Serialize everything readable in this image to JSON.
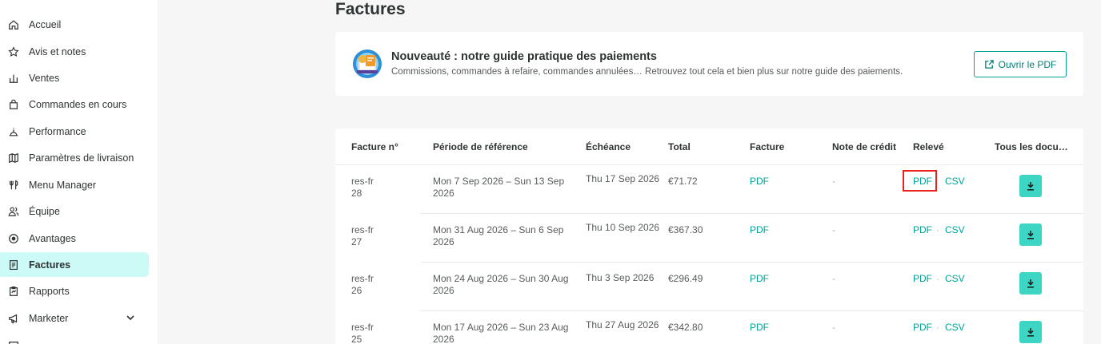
{
  "sidebar": {
    "items": [
      {
        "label": "Accueil",
        "icon": "home-icon"
      },
      {
        "label": "Avis et notes",
        "icon": "star-icon"
      },
      {
        "label": "Ventes",
        "icon": "bar-chart-icon"
      },
      {
        "label": "Commandes en cours",
        "icon": "bag-icon"
      },
      {
        "label": "Performance",
        "icon": "gauge-icon"
      },
      {
        "label": "Paramètres de livraison",
        "icon": "map-icon"
      },
      {
        "label": "Menu Manager",
        "icon": "cutlery-icon"
      },
      {
        "label": "Équipe",
        "icon": "people-icon"
      },
      {
        "label": "Avantages",
        "icon": "badge-icon"
      },
      {
        "label": "Factures",
        "icon": "document-icon",
        "active": true
      },
      {
        "label": "Rapports",
        "icon": "clipboard-icon"
      },
      {
        "label": "Marketer",
        "icon": "megaphone-icon",
        "expandable": true
      }
    ]
  },
  "page": {
    "title": "Factures"
  },
  "banner": {
    "title": "Nouveauté : notre guide pratique des paiements",
    "subtitle": "Commissions, commandes à refaire, commandes annulées… Retrouvez tout cela et bien plus sur notre guide des paiements.",
    "button_label": "Ouvrir le PDF"
  },
  "table": {
    "headers": {
      "invoice_no": "Facture n°",
      "period": "Période de référence",
      "due": "Échéance",
      "total": "Total",
      "invoice": "Facture",
      "credit_note": "Note de crédit",
      "statement": "Relevé",
      "all_docs": "Tous les docu…"
    },
    "rows": [
      {
        "no": "res-fr 28",
        "period": "Mon 7 Sep 2026 – Sun 13 Sep 2026",
        "due": "Thu 17 Sep 2026",
        "total": "€71.72",
        "invoice": "PDF",
        "credit_note": "-",
        "statement_pdf": "PDF",
        "statement_sep": "·",
        "statement_csv": "CSV"
      },
      {
        "no": "res-fr 27",
        "period": "Mon 31 Aug 2026 – Sun 6 Sep 2026",
        "due": "Thu 10 Sep 2026",
        "total": "€367.30",
        "invoice": "PDF",
        "credit_note": "-",
        "statement_pdf": "PDF",
        "statement_sep": "·",
        "statement_csv": "CSV"
      },
      {
        "no": "res-fr 26",
        "period": "Mon 24 Aug 2026 – Sun 30 Aug 2026",
        "due": "Thu 3 Sep 2026",
        "total": "€296.49",
        "invoice": "PDF",
        "credit_note": "-",
        "statement_pdf": "PDF",
        "statement_sep": "·",
        "statement_csv": "CSV"
      },
      {
        "no": "res-fr 25",
        "period": "Mon 17 Aug 2026 – Sun 23 Aug 2026",
        "due": "Thu 27 Aug 2026",
        "total": "€342.80",
        "invoice": "PDF",
        "credit_note": "-",
        "statement_pdf": "PDF",
        "statement_sep": "·",
        "statement_csv": "CSV"
      }
    ]
  },
  "colors": {
    "accent": "#00a396",
    "download_button": "#3dd6c4",
    "active_nav": "#ccfaf6",
    "highlight": "#e8231b"
  }
}
